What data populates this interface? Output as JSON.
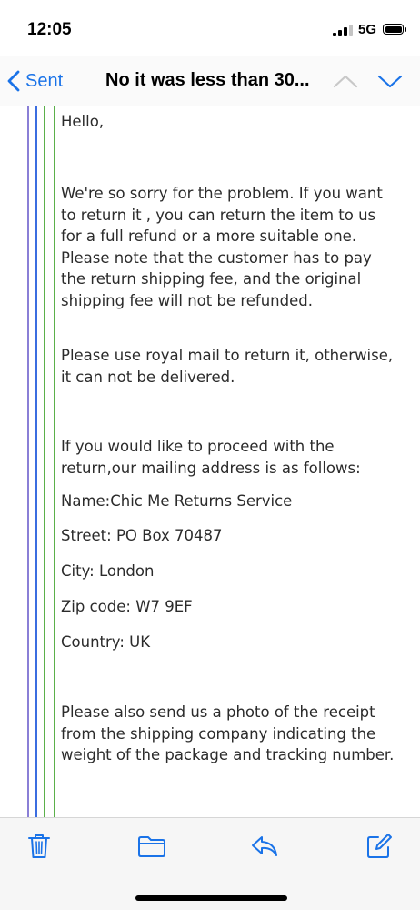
{
  "status_bar": {
    "time": "12:05",
    "network": "5G",
    "icons": [
      "signal-icon",
      "battery-icon"
    ]
  },
  "nav": {
    "back_label": "Sent",
    "title": "No it was less than 30...",
    "icons": [
      "chevron-left-icon",
      "chevron-up-icon",
      "chevron-down-icon"
    ],
    "accent_color": "#1a73e8"
  },
  "message": {
    "paragraphs": [
      "Hello,",
      "We're so sorry for the problem. If you want to return it , you can return the item to us for a full refund or a more suitable one. Please note that the customer has to pay the return shipping fee,  and the original shipping fee will not be refunded.",
      "Please use royal mail to return it, otherwise, it can not be delivered.",
      "If you would like to proceed with the return,our mailing address is as follows:",
      "Name:Chic Me Returns Service",
      "Street: PO Box 70487",
      "City: London",
      "Zip code: W7 9EF",
      "Country: UK",
      "Please also send us a photo of the receipt from the shipping company indicating the weight of the package and tracking number."
    ],
    "quote_colors": [
      "#8a7fd6",
      "#3b6de0",
      "#5bb04a"
    ]
  },
  "toolbar": {
    "icons": [
      "trash-icon",
      "folder-icon",
      "reply-icon",
      "compose-icon"
    ]
  }
}
